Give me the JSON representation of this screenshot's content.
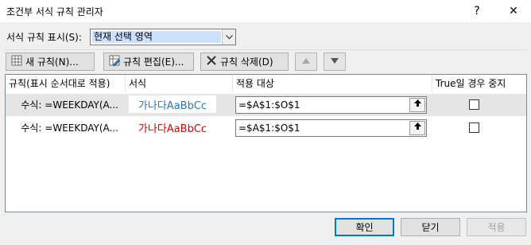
{
  "window": {
    "title": "조건부 서식 규칙 관리자",
    "help_glyph": "?",
    "close_glyph": "✕"
  },
  "show_rules": {
    "label": "서식 규칙 표시(S):",
    "selected": "현재 선택 영역"
  },
  "toolbar": {
    "new_rule": "새 규칙(N)...",
    "edit_rule": "규칙 편집(E)...",
    "delete_rule": "규칙 삭제(D)"
  },
  "table": {
    "columns": [
      "규칙(표시 순서대로 적용)",
      "서식",
      "적용 대상",
      "True일 경우 중지"
    ],
    "rows": [
      {
        "rule": "수식: =WEEKDAY(A...",
        "format_preview": "가나다AaBbCc",
        "format_color": "#2e75b6",
        "applies_to": "=$A$1:$O$1",
        "stop_if_true": false,
        "selected": true
      },
      {
        "rule": "수식: =WEEKDAY(A...",
        "format_preview": "가나다AaBbCc",
        "format_color": "#e00000",
        "applies_to": "=$A$1:$O$1",
        "stop_if_true": false,
        "selected": false
      }
    ]
  },
  "buttons": {
    "ok": "확인",
    "close": "닫기",
    "apply": "적용"
  }
}
